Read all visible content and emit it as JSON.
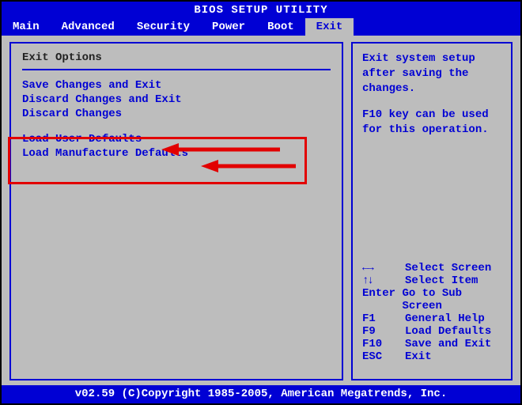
{
  "title": "BIOS SETUP UTILITY",
  "menu": {
    "items": [
      "Main",
      "Advanced",
      "Security",
      "Power",
      "Boot",
      "Exit"
    ],
    "active": "Exit"
  },
  "left": {
    "heading": "Exit Options",
    "group1": [
      "Save Changes and Exit",
      "Discard Changes and Exit",
      "Discard Changes"
    ],
    "group2": [
      "Load User Defaults",
      "Load Manufacture Defaults"
    ]
  },
  "right": {
    "desc_line1": "Exit system setup",
    "desc_line2": "after saving the",
    "desc_line3": "changes.",
    "desc_line4": "F10 key can be used",
    "desc_line5": "for this operation.",
    "nav": [
      {
        "key": "←→",
        "label": "Select Screen"
      },
      {
        "key": "↑↓",
        "label": "Select Item"
      },
      {
        "key": "Enter",
        "label": "Go to Sub Screen"
      },
      {
        "key": "F1",
        "label": "General Help"
      },
      {
        "key": "F9",
        "label": "Load Defaults"
      },
      {
        "key": "F10",
        "label": "Save and Exit"
      },
      {
        "key": "ESC",
        "label": "Exit"
      }
    ]
  },
  "footer": "v02.59 (C)Copyright 1985-2005, American Megatrends, Inc."
}
